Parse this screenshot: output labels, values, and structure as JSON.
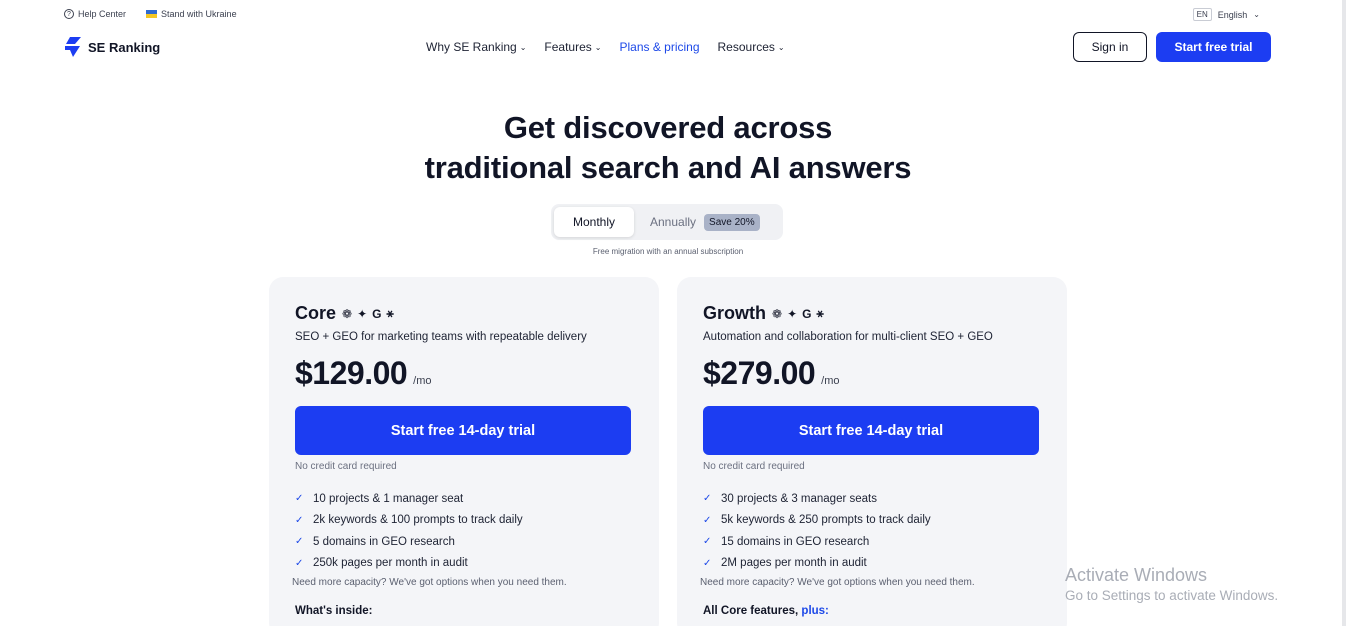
{
  "utility_bar": {
    "help_center": "Help Center",
    "ukraine": "Stand with Ukraine",
    "language_code": "EN",
    "language": "English"
  },
  "header": {
    "logo_text": "SE Ranking",
    "nav": [
      {
        "label": "Why SE Ranking",
        "dropdown": true
      },
      {
        "label": "Features",
        "dropdown": true
      },
      {
        "label": "Plans & pricing",
        "dropdown": false,
        "active": true
      },
      {
        "label": "Resources",
        "dropdown": true
      }
    ],
    "sign_in": "Sign in",
    "start_trial": "Start free trial"
  },
  "hero": {
    "title_line1": "Get discovered across",
    "title_line2": "traditional search and AI answers"
  },
  "billing": {
    "monthly": "Monthly",
    "annually": "Annually",
    "save_badge": "Save 20%",
    "selected": "Monthly",
    "note": "Free migration with an annual subscription"
  },
  "plans": [
    {
      "name": "Core",
      "description": "SEO + GEO for marketing teams with repeatable delivery",
      "price": "$129.00",
      "period": "/mo",
      "cta": "Start free 14-day trial",
      "no_card": "No credit card required",
      "features": [
        "10 projects & 1 manager seat",
        "2k keywords & 100 prompts to track daily",
        "5 domains in GEO research",
        "250k pages per month in audit"
      ],
      "capacity_note": "Need more capacity? We've got options when you need them.",
      "inside_heading": "What's inside:",
      "inside_plus": ""
    },
    {
      "name": "Growth",
      "description": "Automation and collaboration for multi-client SEO + GEO",
      "price": "$279.00",
      "period": "/mo",
      "cta": "Start free 14-day trial",
      "no_card": "No credit card required",
      "features": [
        "30 projects & 3 manager seats",
        "5k keywords & 250 prompts to track daily",
        "15 domains in GEO research",
        "2M pages per month in audit"
      ],
      "capacity_note": "Need more capacity? We've got options when you need them.",
      "inside_heading": "All Core features, ",
      "inside_plus": "plus:"
    }
  ],
  "ai_icons": [
    "chatgpt-icon",
    "gemini-icon",
    "google-icon",
    "perplexity-icon"
  ],
  "watermark": {
    "title": "Activate Windows",
    "subtitle": "Go to Settings to activate Windows."
  },
  "colors": {
    "accent": "#1c3df2",
    "card_bg": "#f4f5f8",
    "text": "#111526"
  }
}
